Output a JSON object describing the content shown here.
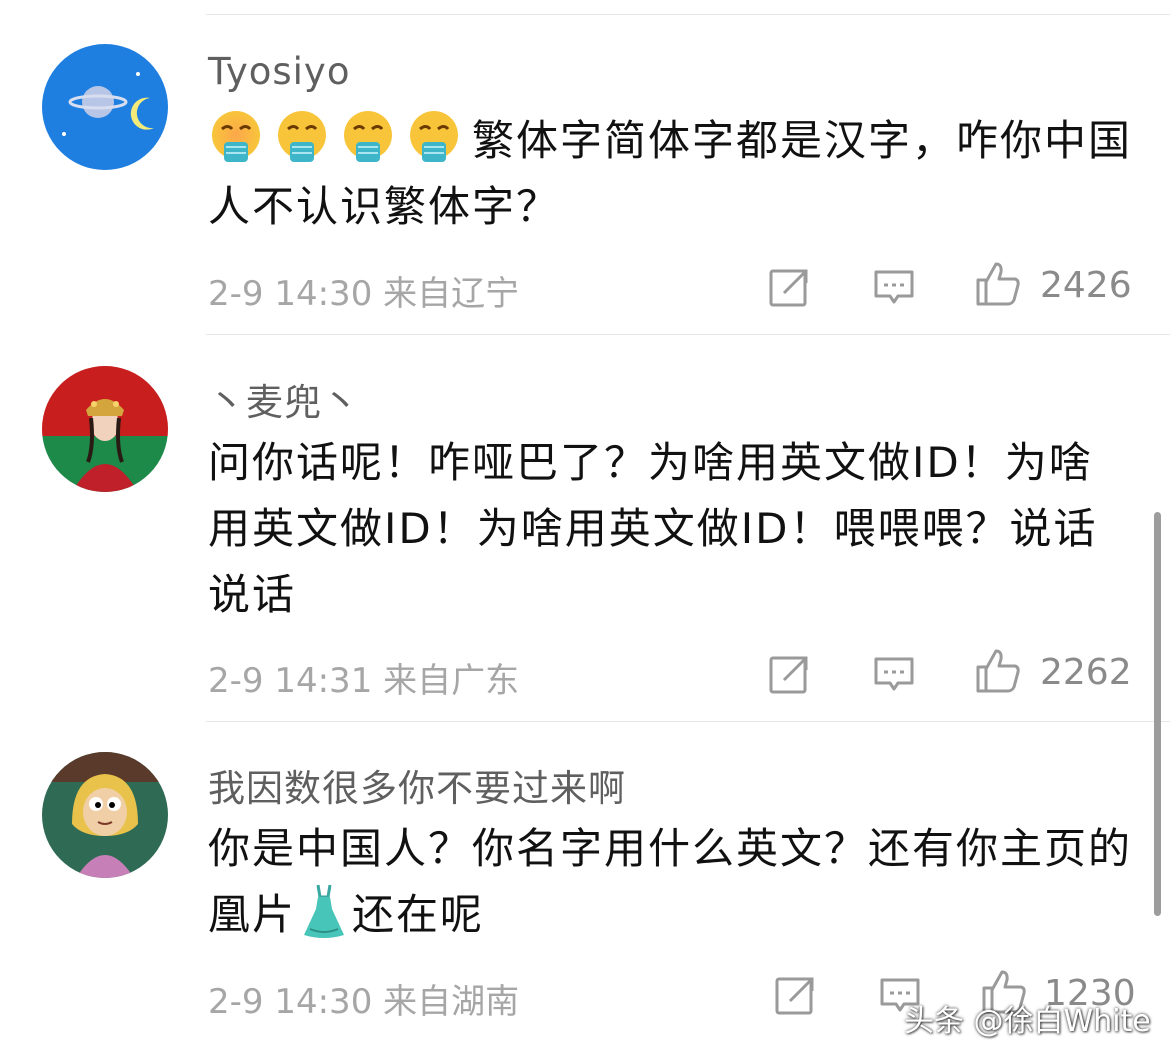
{
  "comments": [
    {
      "username": "Tyosiyo",
      "avatar_icon": "planet-moon-avatar",
      "emoji": [
        "vomiting-face-emoji",
        "vomiting-face-emoji",
        "vomiting-face-emoji",
        "vomiting-face-emoji"
      ],
      "text": "繁体字简体字都是汉字，咋你中国人不认识繁体字？",
      "time": "2-9 14:30",
      "location": "来自辽宁",
      "likes": "2426"
    },
    {
      "username": "丶麦兜丶",
      "avatar_icon": "bride-portrait-avatar",
      "text": "问你话呢！咋哑巴了？为啥用英文做ID！为啥用英文做ID！为啥用英文做ID！喂喂喂？说话说话",
      "time": "2-9 14:31",
      "location": "来自广东",
      "likes": "2262"
    },
    {
      "username": "我因数很多你不要过来啊",
      "avatar_icon": "cartoon-character-avatar",
      "text_before": "你是中国人？你名字用什么英文？还有你主页的凰片",
      "dress_emoji": "dress-emoji",
      "text_after": "还在呢",
      "time": "2-9 14:30",
      "location": "来自湖南",
      "likes": "1230"
    }
  ],
  "icons": {
    "share": "share-icon",
    "reply": "comment-icon",
    "like": "thumbs-up-icon"
  },
  "colors": {
    "username": "#5f5f5f",
    "meta": "#a6a6a6",
    "divider": "#e6e6e6",
    "avatar1_bg": "#1f7fe0"
  },
  "watermark": "头条 @徐白White"
}
